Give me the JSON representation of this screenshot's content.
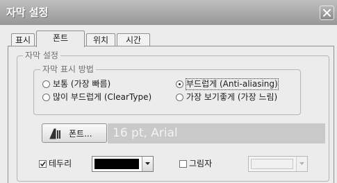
{
  "window": {
    "title": "자막 설정"
  },
  "tabs": [
    {
      "label": "표시",
      "active": false
    },
    {
      "label": "폰트",
      "active": true
    },
    {
      "label": "위치",
      "active": false
    },
    {
      "label": "시간",
      "active": false
    }
  ],
  "subtitle_group": {
    "title": "자막 설정",
    "display_method": {
      "title": "자막 표시 방법",
      "options": [
        {
          "label": "보통 (가장 빠름)",
          "selected": false
        },
        {
          "label": "부드럽게 (Anti-aliasing)",
          "selected": true
        },
        {
          "label": "많이 부드럽게 (ClearType)",
          "selected": false
        },
        {
          "label": "가장 보기좋게 (가장 느림)",
          "selected": false
        }
      ]
    },
    "font_button_label": "폰트...",
    "font_preview": "16 pt, Arial",
    "outline": {
      "label": "테두리",
      "checked": true,
      "color": "#000000"
    },
    "shadow": {
      "label": "그림자",
      "checked": false
    }
  },
  "colors": {
    "titlebar_top": "#bfbfbf",
    "titlebar_bottom": "#979797",
    "dialog_bg": "#ececec",
    "preview_bg": "#c9c9c9"
  },
  "icons": {
    "close": "close-icon",
    "font": "font-icon",
    "dropdown": "chevron-down-icon"
  }
}
